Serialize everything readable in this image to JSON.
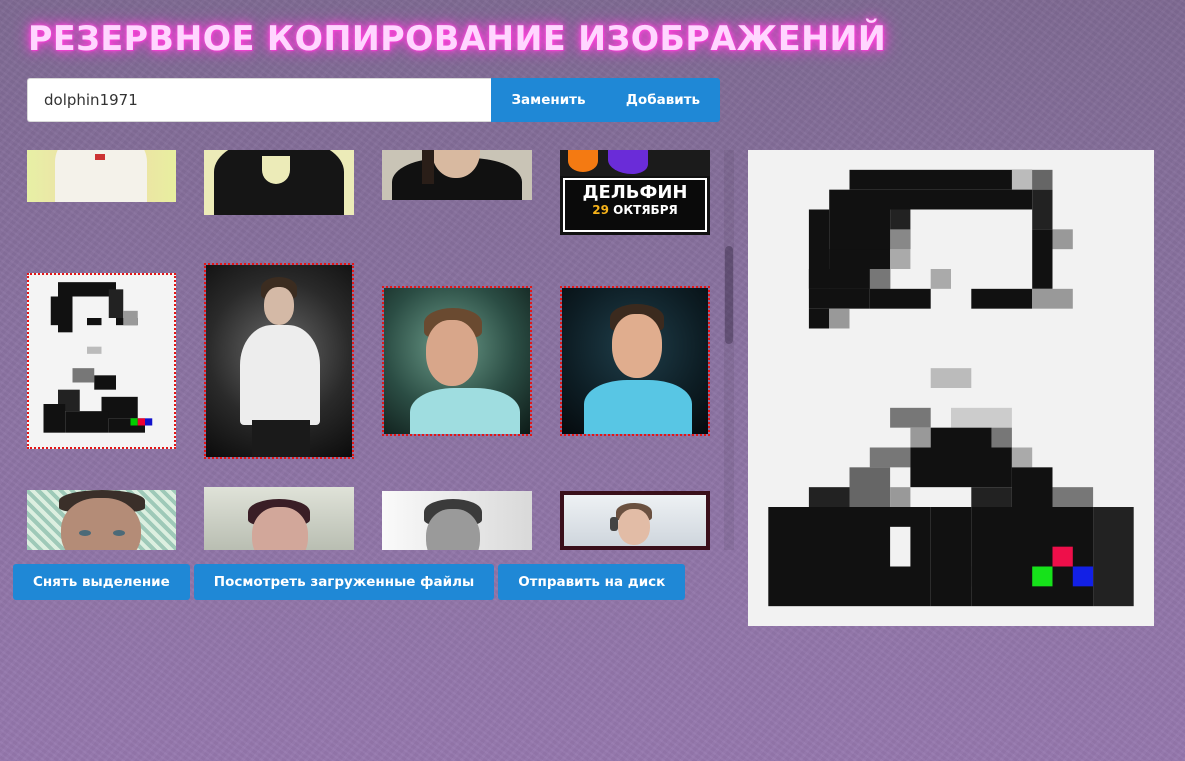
{
  "page": {
    "title": "РЕЗЕРВНОЕ КОПИРОВАНИЕ ИЗОБРАЖЕНИЙ"
  },
  "search": {
    "value": "dolphin1971",
    "replace_label": "Заменить",
    "add_label": "Добавить"
  },
  "gallery": {
    "poster": {
      "title": "ДЕЛЬФИН",
      "date_num": "29",
      "date_month": "ОКТЯБРЯ"
    },
    "selected_count": 4
  },
  "actions": {
    "deselect_label": "Снять выделение",
    "view_uploaded_label": "Посмотреть загруженные файлы",
    "send_to_disk_label": "Отправить на диск"
  },
  "colors": {
    "accent": "#1f88d6",
    "title_glow": "#ff3fd8",
    "selection_border": "#e41616",
    "background": "#8b73a2"
  }
}
